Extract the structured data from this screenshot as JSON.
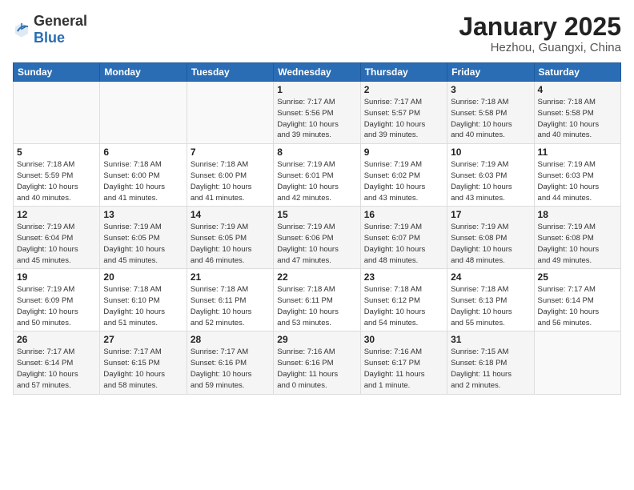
{
  "logo": {
    "general": "General",
    "blue": "Blue"
  },
  "title": {
    "month": "January 2025",
    "location": "Hezhou, Guangxi, China"
  },
  "weekdays": [
    "Sunday",
    "Monday",
    "Tuesday",
    "Wednesday",
    "Thursday",
    "Friday",
    "Saturday"
  ],
  "weeks": [
    [
      {
        "day": "",
        "info": ""
      },
      {
        "day": "",
        "info": ""
      },
      {
        "day": "",
        "info": ""
      },
      {
        "day": "1",
        "info": "Sunrise: 7:17 AM\nSunset: 5:56 PM\nDaylight: 10 hours\nand 39 minutes."
      },
      {
        "day": "2",
        "info": "Sunrise: 7:17 AM\nSunset: 5:57 PM\nDaylight: 10 hours\nand 39 minutes."
      },
      {
        "day": "3",
        "info": "Sunrise: 7:18 AM\nSunset: 5:58 PM\nDaylight: 10 hours\nand 40 minutes."
      },
      {
        "day": "4",
        "info": "Sunrise: 7:18 AM\nSunset: 5:58 PM\nDaylight: 10 hours\nand 40 minutes."
      }
    ],
    [
      {
        "day": "5",
        "info": "Sunrise: 7:18 AM\nSunset: 5:59 PM\nDaylight: 10 hours\nand 40 minutes."
      },
      {
        "day": "6",
        "info": "Sunrise: 7:18 AM\nSunset: 6:00 PM\nDaylight: 10 hours\nand 41 minutes."
      },
      {
        "day": "7",
        "info": "Sunrise: 7:18 AM\nSunset: 6:00 PM\nDaylight: 10 hours\nand 41 minutes."
      },
      {
        "day": "8",
        "info": "Sunrise: 7:19 AM\nSunset: 6:01 PM\nDaylight: 10 hours\nand 42 minutes."
      },
      {
        "day": "9",
        "info": "Sunrise: 7:19 AM\nSunset: 6:02 PM\nDaylight: 10 hours\nand 43 minutes."
      },
      {
        "day": "10",
        "info": "Sunrise: 7:19 AM\nSunset: 6:03 PM\nDaylight: 10 hours\nand 43 minutes."
      },
      {
        "day": "11",
        "info": "Sunrise: 7:19 AM\nSunset: 6:03 PM\nDaylight: 10 hours\nand 44 minutes."
      }
    ],
    [
      {
        "day": "12",
        "info": "Sunrise: 7:19 AM\nSunset: 6:04 PM\nDaylight: 10 hours\nand 45 minutes."
      },
      {
        "day": "13",
        "info": "Sunrise: 7:19 AM\nSunset: 6:05 PM\nDaylight: 10 hours\nand 45 minutes."
      },
      {
        "day": "14",
        "info": "Sunrise: 7:19 AM\nSunset: 6:05 PM\nDaylight: 10 hours\nand 46 minutes."
      },
      {
        "day": "15",
        "info": "Sunrise: 7:19 AM\nSunset: 6:06 PM\nDaylight: 10 hours\nand 47 minutes."
      },
      {
        "day": "16",
        "info": "Sunrise: 7:19 AM\nSunset: 6:07 PM\nDaylight: 10 hours\nand 48 minutes."
      },
      {
        "day": "17",
        "info": "Sunrise: 7:19 AM\nSunset: 6:08 PM\nDaylight: 10 hours\nand 48 minutes."
      },
      {
        "day": "18",
        "info": "Sunrise: 7:19 AM\nSunset: 6:08 PM\nDaylight: 10 hours\nand 49 minutes."
      }
    ],
    [
      {
        "day": "19",
        "info": "Sunrise: 7:19 AM\nSunset: 6:09 PM\nDaylight: 10 hours\nand 50 minutes."
      },
      {
        "day": "20",
        "info": "Sunrise: 7:18 AM\nSunset: 6:10 PM\nDaylight: 10 hours\nand 51 minutes."
      },
      {
        "day": "21",
        "info": "Sunrise: 7:18 AM\nSunset: 6:11 PM\nDaylight: 10 hours\nand 52 minutes."
      },
      {
        "day": "22",
        "info": "Sunrise: 7:18 AM\nSunset: 6:11 PM\nDaylight: 10 hours\nand 53 minutes."
      },
      {
        "day": "23",
        "info": "Sunrise: 7:18 AM\nSunset: 6:12 PM\nDaylight: 10 hours\nand 54 minutes."
      },
      {
        "day": "24",
        "info": "Sunrise: 7:18 AM\nSunset: 6:13 PM\nDaylight: 10 hours\nand 55 minutes."
      },
      {
        "day": "25",
        "info": "Sunrise: 7:17 AM\nSunset: 6:14 PM\nDaylight: 10 hours\nand 56 minutes."
      }
    ],
    [
      {
        "day": "26",
        "info": "Sunrise: 7:17 AM\nSunset: 6:14 PM\nDaylight: 10 hours\nand 57 minutes."
      },
      {
        "day": "27",
        "info": "Sunrise: 7:17 AM\nSunset: 6:15 PM\nDaylight: 10 hours\nand 58 minutes."
      },
      {
        "day": "28",
        "info": "Sunrise: 7:17 AM\nSunset: 6:16 PM\nDaylight: 10 hours\nand 59 minutes."
      },
      {
        "day": "29",
        "info": "Sunrise: 7:16 AM\nSunset: 6:16 PM\nDaylight: 11 hours\nand 0 minutes."
      },
      {
        "day": "30",
        "info": "Sunrise: 7:16 AM\nSunset: 6:17 PM\nDaylight: 11 hours\nand 1 minute."
      },
      {
        "day": "31",
        "info": "Sunrise: 7:15 AM\nSunset: 6:18 PM\nDaylight: 11 hours\nand 2 minutes."
      },
      {
        "day": "",
        "info": ""
      }
    ]
  ]
}
